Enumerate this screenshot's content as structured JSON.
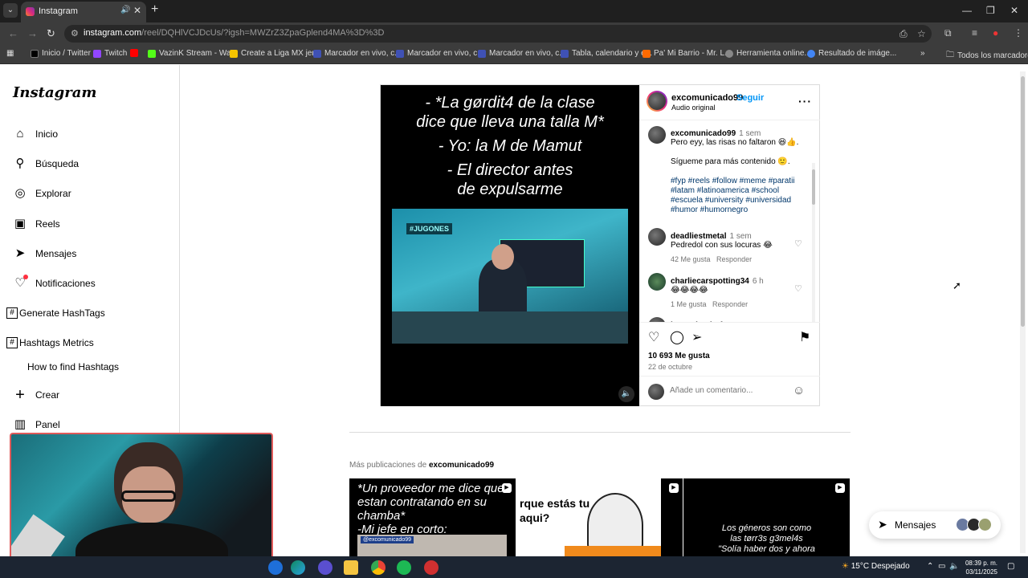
{
  "browser": {
    "tab_title": "Instagram",
    "url_host": "instagram.com",
    "url_path": "/reel/DQHlVCJDcUs/?igsh=MWZrZ3ZpaGplend4MA%3D%3D",
    "bookmarks": [
      {
        "label": "Inicio / Twitter",
        "color": "#000000"
      },
      {
        "label": "Twitch",
        "color": "#9146ff"
      },
      {
        "label": "",
        "color": "#ff0000"
      },
      {
        "label": "VazinK Stream - Wa...",
        "color": "#53fc18"
      },
      {
        "label": "Create a Liga MX jer...",
        "color": "#f5c400"
      },
      {
        "label": "Marcador en vivo, c...",
        "color": "#3f51b5"
      },
      {
        "label": "Marcador en vivo, c...",
        "color": "#3f51b5"
      },
      {
        "label": "Marcador en vivo, c...",
        "color": "#3f51b5"
      },
      {
        "label": "Tabla, calendario y e...",
        "color": "#3f51b5"
      },
      {
        "label": "Pa' Mi Barrio - Mr. L...",
        "color": "#ff6a00"
      },
      {
        "label": "Herramienta online...",
        "color": "#888888"
      },
      {
        "label": "Resultado de imáge...",
        "color": "#4285f4"
      }
    ],
    "all_bookmarks": "Todos los marcadores"
  },
  "sidebar": {
    "logo": "Instagram",
    "items": [
      {
        "label": "Inicio",
        "icon": "home-icon",
        "glyph": "⌂"
      },
      {
        "label": "Búsqueda",
        "icon": "search-icon",
        "glyph": "⚲"
      },
      {
        "label": "Explorar",
        "icon": "compass-icon",
        "glyph": "◎"
      },
      {
        "label": "Reels",
        "icon": "reels-icon",
        "glyph": "▣"
      },
      {
        "label": "Mensajes",
        "icon": "messages-icon",
        "glyph": "➤"
      },
      {
        "label": "Notificaciones",
        "icon": "heart-icon",
        "glyph": "♡"
      }
    ],
    "generate_hashtags": "Generate HashTags",
    "hashtags_metrics": "Hashtags Metrics",
    "how_to_find": "How to find Hashtags",
    "crear": "Crear",
    "panel": "Panel"
  },
  "post": {
    "video_caption": [
      "- *La gørdit4 de la clase",
      "dice que lleva una talla M*",
      "- Yo: la M de Mamut",
      "- El director antes",
      "de expulsarme"
    ],
    "video_tag": "#JUGONES",
    "author": "excomunicado99",
    "follow": "Seguir",
    "audio": "Audio original",
    "caption_time": "1 sem",
    "caption_line1": "Pero eyy, las risas no faltaron 😆👍.",
    "caption_line2": "Sígueme para más contenido 🙂.",
    "hashtags": "#fyp #reels #follow #meme #paratii #latam #latinoamerica #school #escuela #university #universidad #humor #humornegro",
    "comments": [
      {
        "user": "deadliestmetal",
        "time": "1 sem",
        "text": "Pedredol con sus locuras 😂",
        "likes": "42 Me gusta",
        "reply": "Responder"
      },
      {
        "user": "charliecarspotting34",
        "time": "6 h",
        "text": "😂😂😂😂",
        "likes": "1 Me gusta",
        "reply": "Responder"
      },
      {
        "user": "jesuschuchofc",
        "time": "",
        "text": "",
        "likes": "",
        "reply": ""
      }
    ],
    "like_count": "10 693 Me gusta",
    "date": "22 de octubre",
    "comment_placeholder": "Añade un comentario..."
  },
  "more_pubs": {
    "prefix": "Más publicaciones de",
    "user": "excomunicado99",
    "thumbs": [
      {
        "lines": [
          "*Un proveedor me dice que",
          "estan contratando en su",
          "chamba*",
          "-Mi jefe en corto:"
        ],
        "badge": "@excomunicado99"
      },
      {
        "lines": [
          "rque estás tu",
          "aqui?"
        ],
        "badge": ""
      },
      {
        "lines": [
          "Los géneros son como",
          "las tørr3s g3mel4s",
          "\"Solía haber dos y ahora"
        ],
        "badge": ""
      }
    ]
  },
  "messages_pill": "Mensajes",
  "taskbar": {
    "weather": "15°C  Despejado",
    "time": "08:39 p. m.",
    "date": "03/11/2025"
  }
}
